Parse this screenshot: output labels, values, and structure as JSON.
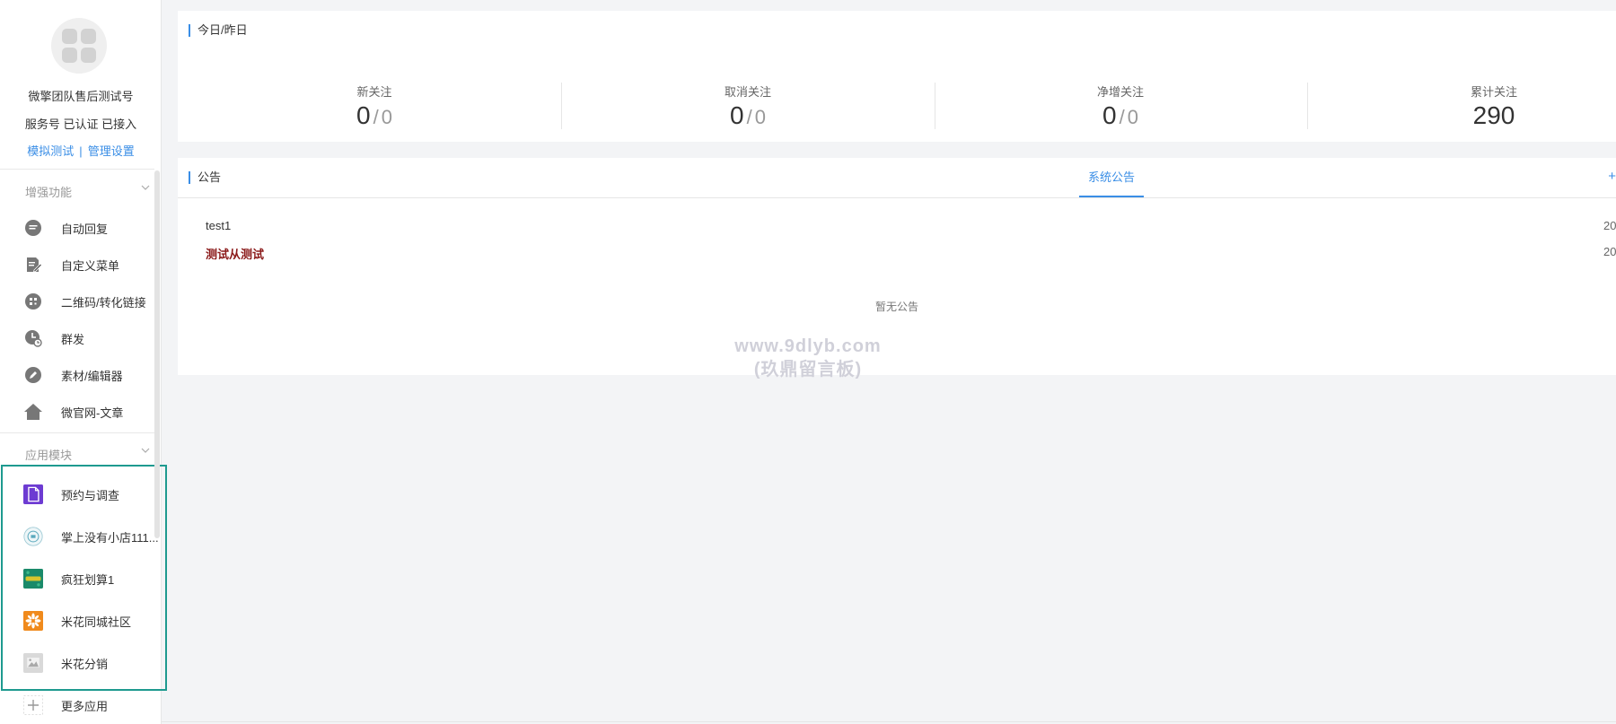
{
  "account": {
    "name": "微擎团队售后测试号",
    "status": "服务号 已认证 已接入",
    "links": [
      "模拟测试",
      "管理设置"
    ],
    "link_separator": "|"
  },
  "sidebar": {
    "enhanced_title": "增强功能",
    "enhanced_items": [
      {
        "label": "自动回复",
        "icon": "chat-bubble-icon"
      },
      {
        "label": "自定义菜单",
        "icon": "edit-document-icon"
      },
      {
        "label": "二维码/转化链接",
        "icon": "qrcode-icon"
      },
      {
        "label": "群发",
        "icon": "clock-send-icon"
      },
      {
        "label": "素材/编辑器",
        "icon": "pencil-icon"
      },
      {
        "label": "微官网-文章",
        "icon": "home-icon"
      }
    ],
    "modules_title": "应用模块",
    "module_items": [
      {
        "label": "预约与调查",
        "icon": "purple-document-icon"
      },
      {
        "label": "掌上没有小店111...",
        "icon": "shop-badge-icon"
      },
      {
        "label": "疯狂划算1",
        "icon": "green-banner-icon"
      },
      {
        "label": "米花同城社区",
        "icon": "orange-flower-icon"
      },
      {
        "label": "米花分销",
        "icon": "placeholder-image-icon"
      }
    ],
    "more_apps": "更多应用"
  },
  "stats": {
    "title": "今日/昨日",
    "items": [
      {
        "label": "新关注",
        "today": "0",
        "yesterday": "0"
      },
      {
        "label": "取消关注",
        "today": "0",
        "yesterday": "0"
      },
      {
        "label": "净增关注",
        "today": "0",
        "yesterday": "0"
      },
      {
        "label": "累计关注",
        "total": "290"
      }
    ]
  },
  "notices": {
    "title": "公告",
    "tab": "系统公告",
    "more": "+",
    "items": [
      {
        "title": "test1",
        "date": "20",
        "color": "#333333"
      },
      {
        "title": "测试从测试",
        "date": "20",
        "color": "#8b1a1a"
      }
    ],
    "empty": "暂无公告"
  },
  "watermark": [
    "www.9dlyb.com",
    "(玖鼎留言板)"
  ],
  "colors": {
    "accent": "#3a8ee6",
    "highlight_box": "#1e9a8f"
  }
}
